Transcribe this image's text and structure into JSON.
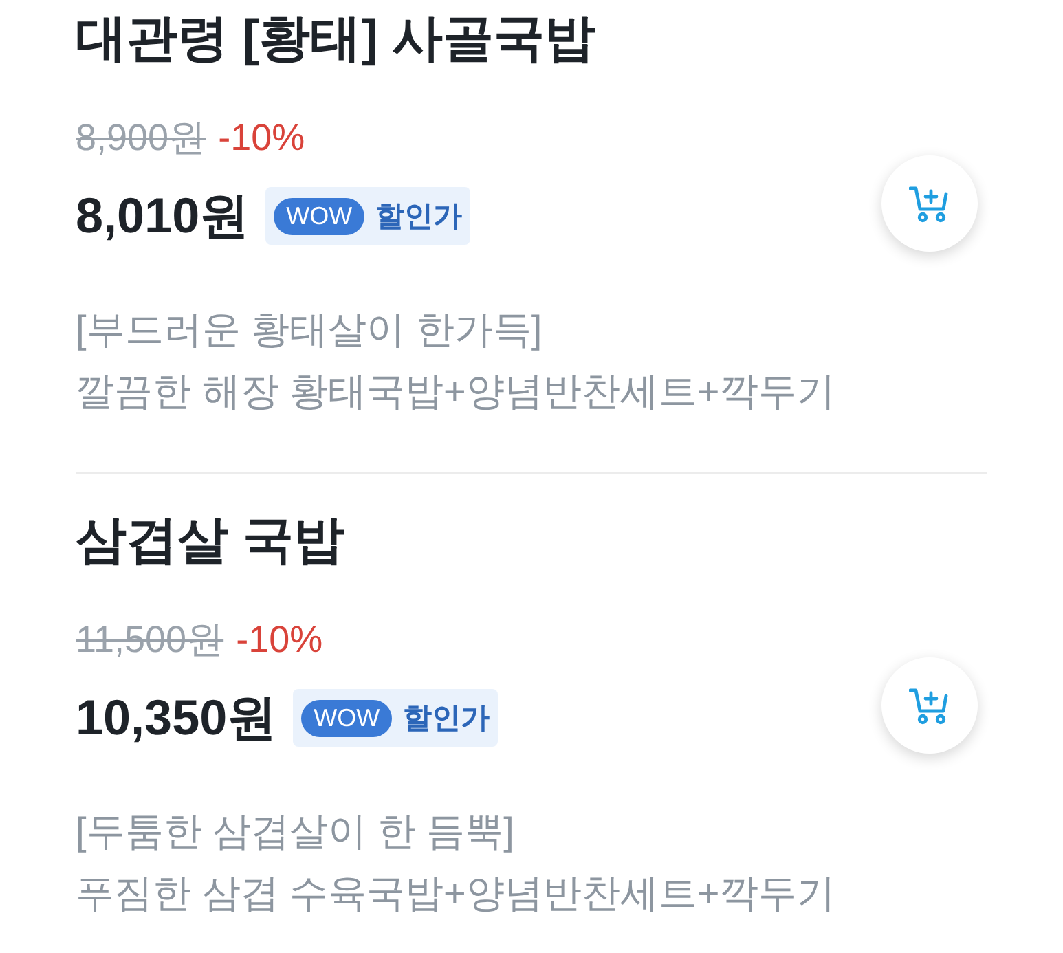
{
  "products": [
    {
      "name": "대관령 [황태] 사골국밥",
      "original_price": "8,900원",
      "discount": "-10%",
      "price": "8,010원",
      "badge": {
        "tag": "WOW",
        "label": "할인가"
      },
      "description": [
        "[부드러운 황태살이 한가득]",
        "깔끔한 해장 황태국밥+양념반찬세트+깍두기"
      ]
    },
    {
      "name": "삼겹살 국밥",
      "original_price": "11,500원",
      "discount": "-10%",
      "price": "10,350원",
      "badge": {
        "tag": "WOW",
        "label": "할인가"
      },
      "description": [
        "[두툼한 삼겹살이 한 듬뿍]",
        "푸짐한 삼겹 수육국밥+양념반찬세트+깍두기"
      ]
    }
  ]
}
